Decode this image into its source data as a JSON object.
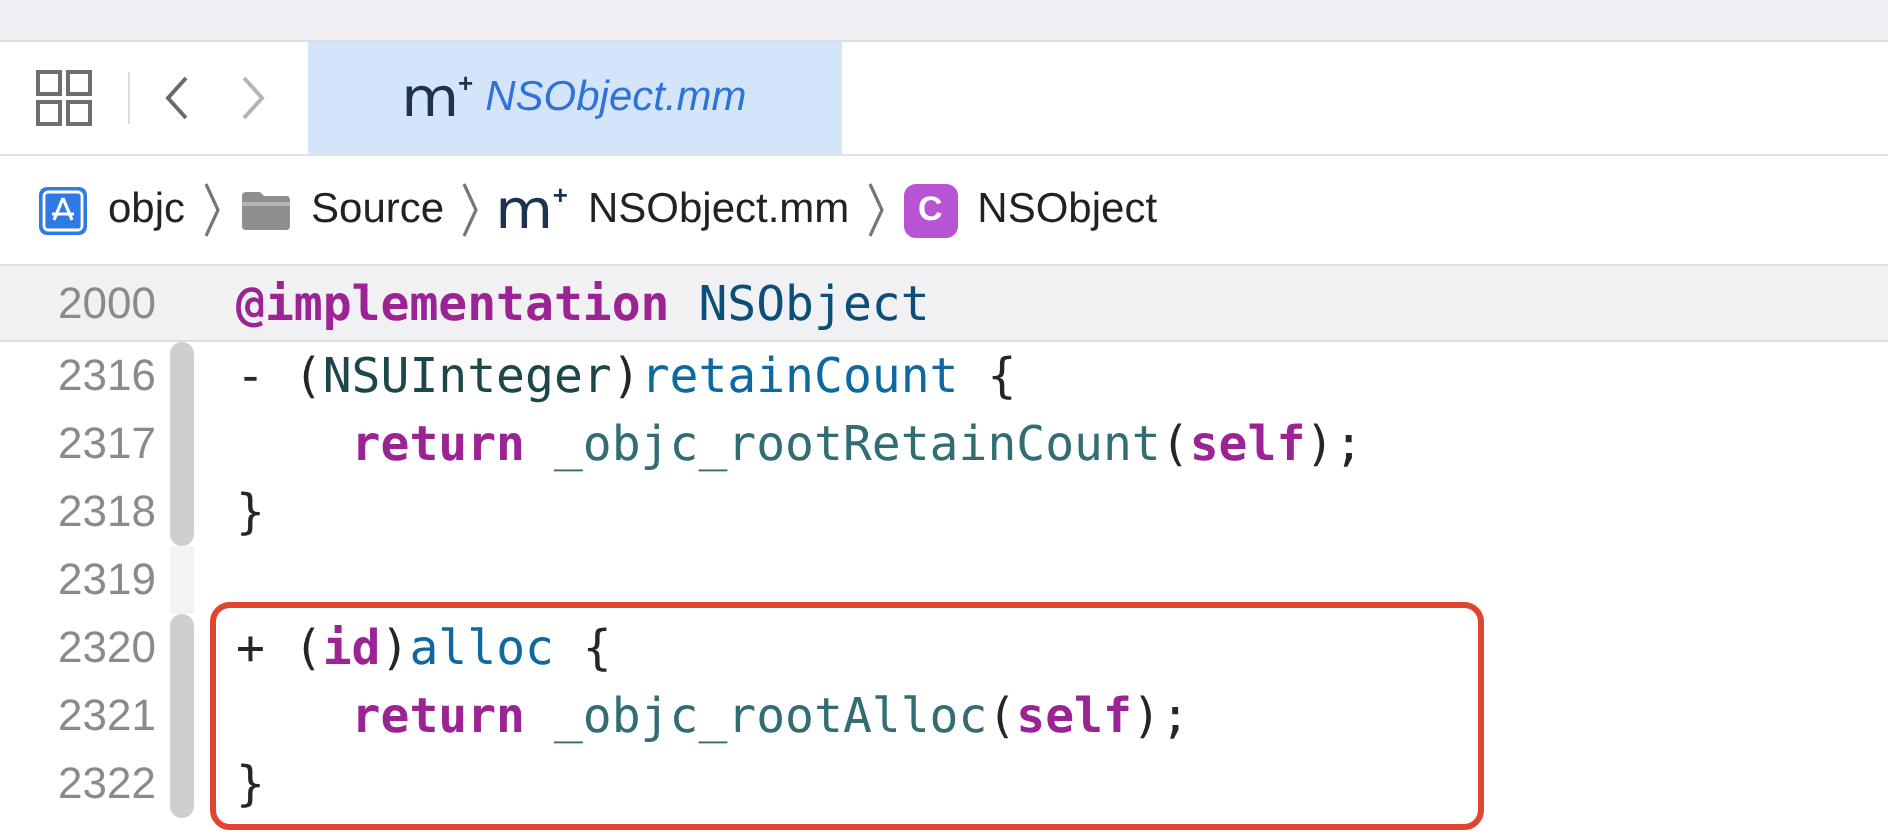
{
  "toolbar": {
    "back": {
      "disabled": false
    },
    "forward": {
      "disabled": true
    }
  },
  "tabs": [
    {
      "icon_letter": "m",
      "icon_mark": "+",
      "label": "NSObject.mm",
      "selected": true
    }
  ],
  "breadcrumb": [
    {
      "kind": "project",
      "label": "objc"
    },
    {
      "kind": "folder",
      "label": "Source"
    },
    {
      "kind": "file",
      "icon_letter": "m",
      "icon_mark": "+",
      "label": "NSObject.mm"
    },
    {
      "kind": "class",
      "icon_letter": "C",
      "label": "NSObject"
    }
  ],
  "editor": {
    "sticky_header": {
      "number": "2000",
      "tokens": [
        {
          "text": "@implementation",
          "kind": "keyword"
        },
        {
          "text": " NSObject",
          "kind": "class"
        }
      ]
    },
    "lines": [
      {
        "number": "2316",
        "changed": true,
        "boxed": false,
        "indented": false,
        "tokens": [
          {
            "text": "- (",
            "kind": "plain"
          },
          {
            "text": "NSUInteger",
            "kind": "type"
          },
          {
            "text": ")",
            "kind": "plain"
          },
          {
            "text": "retainCount",
            "kind": "method"
          },
          {
            "text": " {",
            "kind": "plain"
          }
        ]
      },
      {
        "number": "2317",
        "changed": true,
        "boxed": false,
        "indented": true,
        "tokens": [
          {
            "text": "return",
            "kind": "keyword"
          },
          {
            "text": " _objc_rootRetainCount",
            "kind": "function"
          },
          {
            "text": "(",
            "kind": "plain"
          },
          {
            "text": "self",
            "kind": "keyword"
          },
          {
            "text": ");",
            "kind": "plain"
          }
        ]
      },
      {
        "number": "2318",
        "changed": true,
        "boxed": false,
        "indented": false,
        "tokens": [
          {
            "text": "}",
            "kind": "plain"
          }
        ]
      },
      {
        "number": "2319",
        "changed": false,
        "boxed": false
      },
      {
        "number": "2320",
        "changed": true,
        "boxed": true,
        "indented": false,
        "tokens": [
          {
            "text": "+ (",
            "kind": "plain"
          },
          {
            "text": "id",
            "kind": "keyword"
          },
          {
            "text": ")",
            "kind": "plain"
          },
          {
            "text": "alloc",
            "kind": "method"
          },
          {
            "text": " {",
            "kind": "plain"
          }
        ]
      },
      {
        "number": "2321",
        "changed": true,
        "boxed": true,
        "indented": true,
        "tokens": [
          {
            "text": "return",
            "kind": "keyword"
          },
          {
            "text": " _objc_rootAlloc",
            "kind": "function"
          },
          {
            "text": "(",
            "kind": "plain"
          },
          {
            "text": "self",
            "kind": "keyword"
          },
          {
            "text": ");",
            "kind": "plain"
          }
        ]
      },
      {
        "number": "2322",
        "changed": true,
        "boxed": true,
        "indented": false,
        "tokens": [
          {
            "text": "}",
            "kind": "plain"
          }
        ]
      }
    ]
  }
}
